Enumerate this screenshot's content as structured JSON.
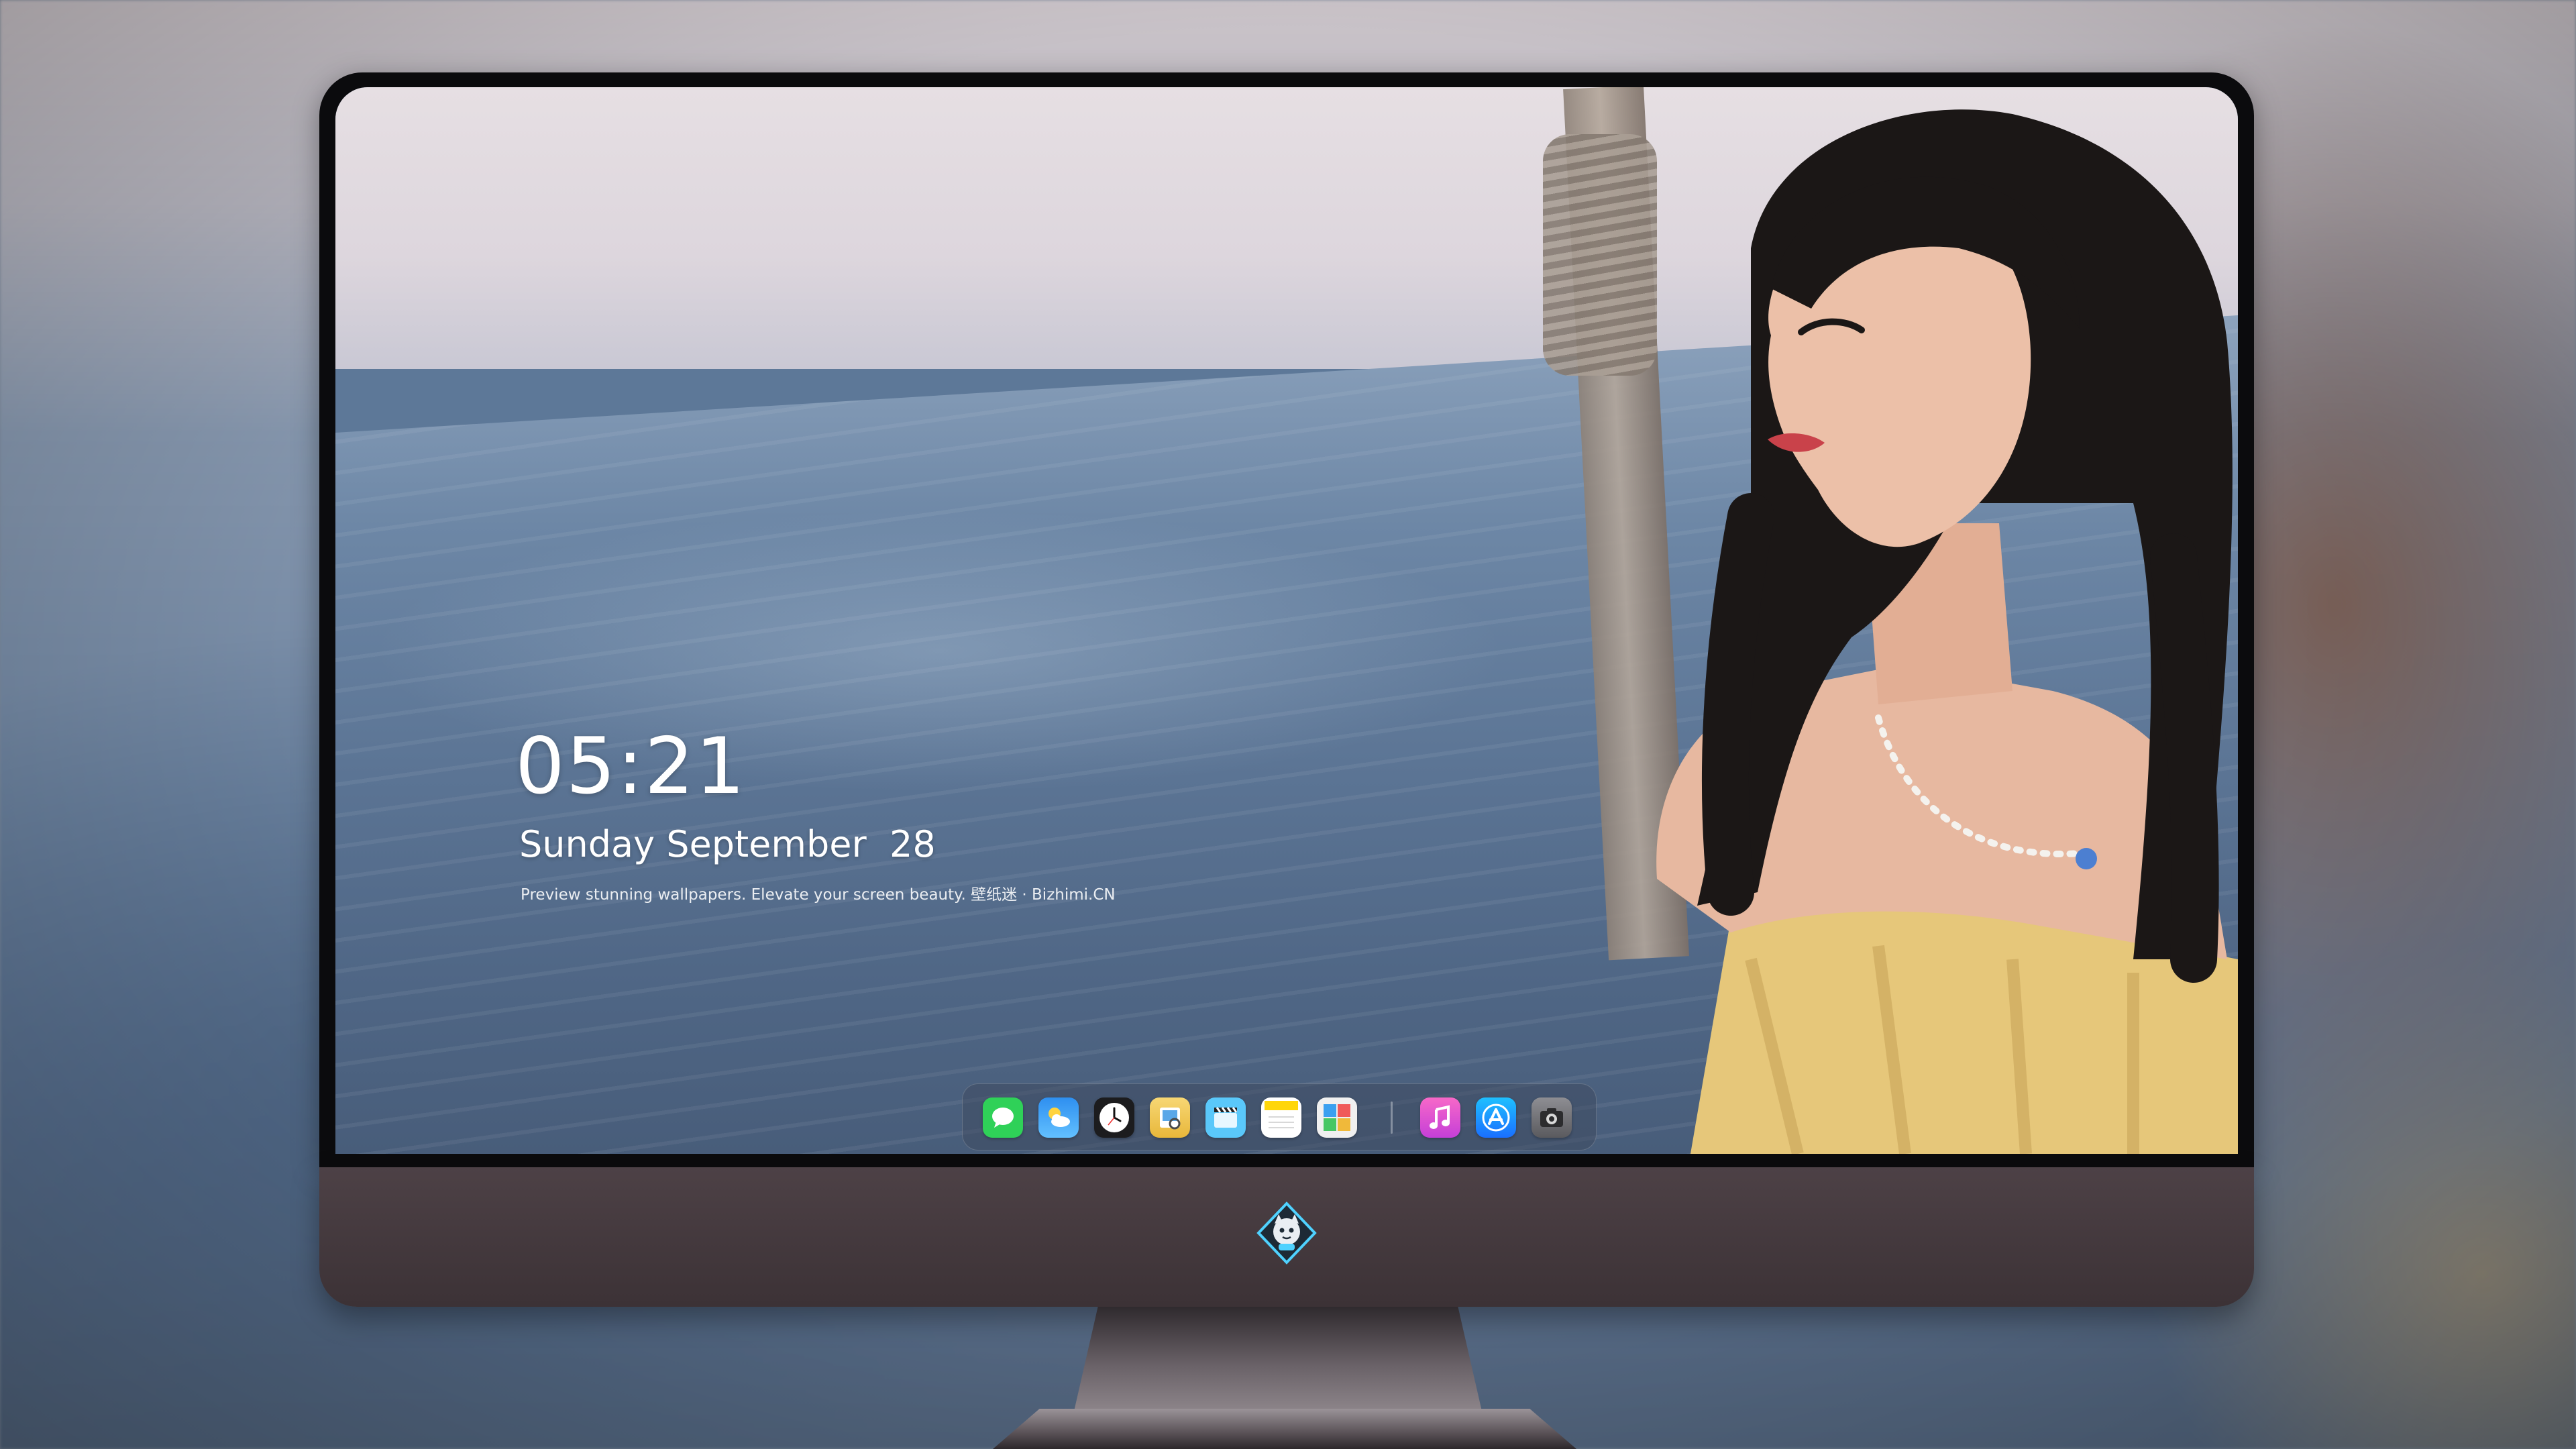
{
  "lockscreen": {
    "time": "05:21",
    "date": "Sunday September  28",
    "tagline": "Preview stunning wallpapers. Elevate your screen beauty. 壁纸迷 · Bizhimi.CN"
  },
  "dock": {
    "apps": [
      {
        "icon": "messages-icon",
        "color": "#2fd158"
      },
      {
        "icon": "weather-icon",
        "color": "#1e9bf0"
      },
      {
        "icon": "clock-icon",
        "color": "#1c1c1e"
      },
      {
        "icon": "preview-icon",
        "color": "#f2c94c"
      },
      {
        "icon": "clips-icon",
        "color": "#5ac8fa"
      },
      {
        "icon": "notes-icon",
        "color": "#ffd60a"
      },
      {
        "icon": "photo-booth-icon",
        "color": "#f0f0f0"
      },
      {
        "icon": "music-icon",
        "color": "#ea4cc0"
      },
      {
        "icon": "app-store-icon",
        "color": "#1a8cff"
      },
      {
        "icon": "camera-icon",
        "color": "#6e6e73"
      }
    ]
  },
  "colors": {
    "monitor_chin": "#453a3f",
    "bezel": "#0b0b0d",
    "text": "#ffffff"
  }
}
